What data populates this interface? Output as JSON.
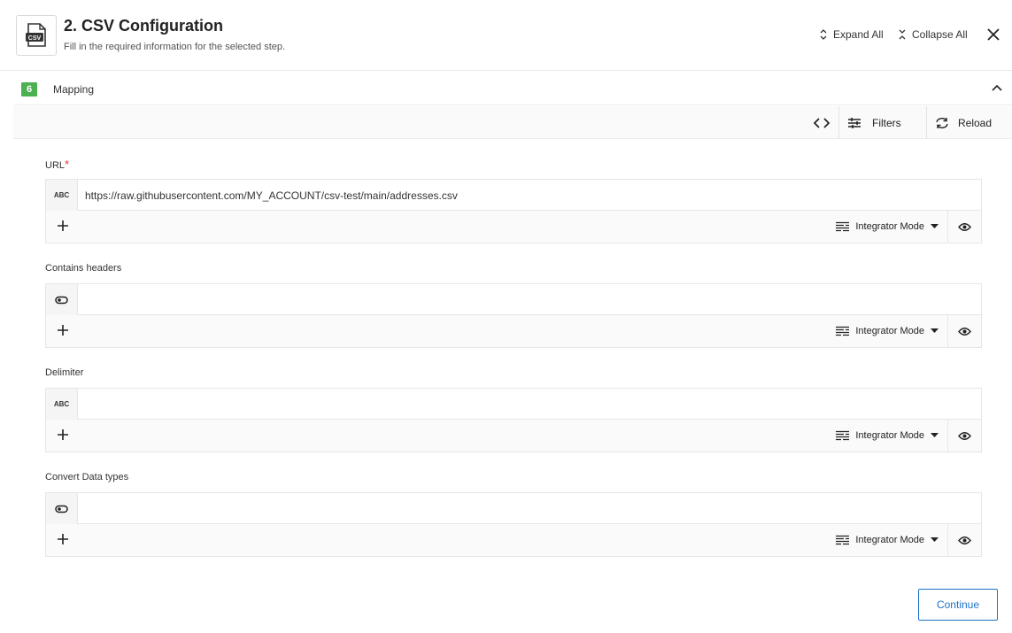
{
  "header": {
    "title": "2. CSV Configuration",
    "subtitle": "Fill in the required information for the selected step.",
    "logo_icon": "csv-file-icon",
    "expand_all": "Expand All",
    "collapse_all": "Collapse All"
  },
  "section": {
    "badge": "6",
    "title": "Mapping"
  },
  "toolbar": {
    "filters": "Filters",
    "reload": "Reload"
  },
  "fields": [
    {
      "label": "URL",
      "required": "*",
      "type": "ABC",
      "value": "https://raw.githubusercontent.com/MY_ACCOUNT/csv-test/main/addresses.csv",
      "mode": "Integrator Mode"
    },
    {
      "label": "Contains headers",
      "type": "toggle",
      "value": "",
      "mode": "Integrator Mode"
    },
    {
      "label": "Delimiter",
      "type": "ABC",
      "value": "",
      "mode": "Integrator Mode"
    },
    {
      "label": "Convert Data types",
      "type": "toggle",
      "value": "",
      "mode": "Integrator Mode"
    }
  ],
  "footer": {
    "continue": "Continue"
  }
}
